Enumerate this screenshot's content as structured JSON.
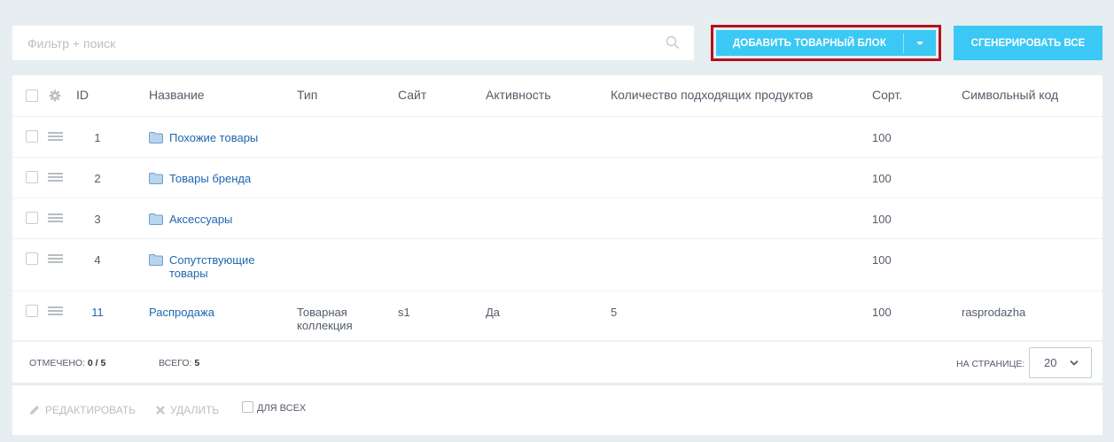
{
  "toolbar": {
    "search_placeholder": "Фильтр + поиск",
    "add_button": "ДОБАВИТЬ ТОВАРНЫЙ БЛОК",
    "generate_button": "СГЕНЕРИРОВАТЬ ВСЕ",
    "accent_color": "#3bc8f5",
    "highlight_color": "#b4121b"
  },
  "grid": {
    "columns": {
      "id": "ID",
      "name": "Название",
      "type": "Тип",
      "site": "Сайт",
      "active": "Активность",
      "count": "Количество подходящих продуктов",
      "sort": "Сорт.",
      "code": "Символьный код"
    },
    "rows": [
      {
        "id": "1",
        "name": "Похожие товары",
        "type": "",
        "site": "",
        "active": "",
        "count": "",
        "sort": "100",
        "code": "",
        "icon": "folder-icon"
      },
      {
        "id": "2",
        "name": "Товары бренда",
        "type": "",
        "site": "",
        "active": "",
        "count": "",
        "sort": "100",
        "code": "",
        "icon": "folder-icon"
      },
      {
        "id": "3",
        "name": "Аксессуары",
        "type": "",
        "site": "",
        "active": "",
        "count": "",
        "sort": "100",
        "code": "",
        "icon": "folder-icon"
      },
      {
        "id": "4",
        "name_line1": "Сопутствующие",
        "name_line2": "товары",
        "type": "",
        "site": "",
        "active": "",
        "count": "",
        "sort": "100",
        "code": "",
        "icon": "folder-icon"
      },
      {
        "id": "11",
        "name": "Распродажа",
        "type_line1": "Товарная",
        "type_line2": "коллекция",
        "site": "s1",
        "active": "Да",
        "count": "5",
        "sort": "100",
        "code": "rasprodazha"
      }
    ],
    "footer": {
      "checked_label": "ОТМЕЧЕНО:",
      "checked_value": "0 / 5",
      "total_label": "ВСЕГО:",
      "total_value": "5",
      "per_page_label": "НА СТРАНИЦЕ:",
      "per_page_value": "20"
    }
  },
  "actions": {
    "edit": "РЕДАКТИРОВАТЬ",
    "delete": "УДАЛИТЬ",
    "for_all": "ДЛЯ ВСЕХ"
  }
}
